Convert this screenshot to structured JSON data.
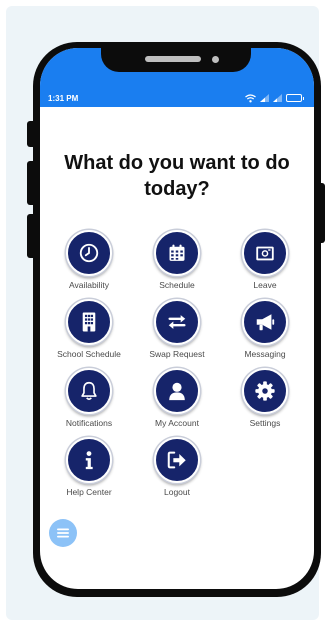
{
  "status_bar": {
    "time": "1:31 PM",
    "icons": [
      "wifi-icon",
      "signal-icon",
      "signal-icon",
      "battery-icon"
    ]
  },
  "main": {
    "heading": "What do you want to do today?"
  },
  "menu": {
    "items": [
      {
        "label": "Availability",
        "icon": "clock-icon"
      },
      {
        "label": "Schedule",
        "icon": "calendar-icon"
      },
      {
        "label": "Leave",
        "icon": "camera-icon"
      },
      {
        "label": "School Schedule",
        "icon": "building-icon"
      },
      {
        "label": "Swap Request",
        "icon": "swap-arrows-icon"
      },
      {
        "label": "Messaging",
        "icon": "megaphone-icon"
      },
      {
        "label": "Notifications",
        "icon": "bell-icon"
      },
      {
        "label": "My Account",
        "icon": "user-icon"
      },
      {
        "label": "Settings",
        "icon": "gear-icon"
      },
      {
        "label": "Help Center",
        "icon": "info-icon"
      },
      {
        "label": "Logout",
        "icon": "logout-icon"
      }
    ]
  },
  "fab": {
    "icon": "menu-icon"
  },
  "colors": {
    "status_bar": "#1a7ef0",
    "icon_circle": "#16246a",
    "fab": "#8cc2f7",
    "background": "#edf4f8"
  }
}
